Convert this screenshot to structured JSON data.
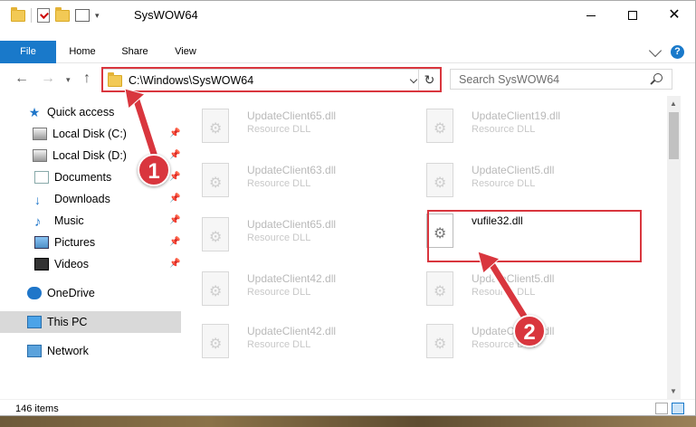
{
  "window": {
    "title": "SysWOW64"
  },
  "ribbon": {
    "tabs": [
      {
        "label": "File"
      },
      {
        "label": "Home"
      },
      {
        "label": "Share"
      },
      {
        "label": "View"
      }
    ]
  },
  "nav": {
    "address": "C:\\Windows\\SysWOW64",
    "search_placeholder": "Search SysWOW64"
  },
  "sidebar": {
    "items": [
      {
        "label": "Quick access"
      },
      {
        "label": "Local Disk (C:)"
      },
      {
        "label": "Local Disk (D:)"
      },
      {
        "label": "Documents"
      },
      {
        "label": "Downloads"
      },
      {
        "label": "Music"
      },
      {
        "label": "Pictures"
      },
      {
        "label": "Videos"
      },
      {
        "label": "OneDrive"
      },
      {
        "label": "This PC"
      },
      {
        "label": "Network"
      }
    ]
  },
  "files": [
    {
      "name": "UpdateClient65.dll",
      "type": "Resource DLL"
    },
    {
      "name": "UpdateClient19.dll",
      "type": "Resource DLL"
    },
    {
      "name": "UpdateClient63.dll",
      "type": "Resource DLL"
    },
    {
      "name": "UpdateClient5.dll",
      "type": "Resource DLL"
    },
    {
      "name": "UpdateClient65.dll",
      "type": "Resource DLL"
    },
    {
      "name": "vufile32.dll",
      "type": ""
    },
    {
      "name": "UpdateClient42.dll",
      "type": "Resource DLL"
    },
    {
      "name": "UpdateClient5.dll",
      "type": "Resource DLL"
    },
    {
      "name": "UpdateClient42.dll",
      "type": "Resource DLL"
    },
    {
      "name": "UpdateClient5.dll",
      "type": "Resource DLL"
    }
  ],
  "status": {
    "item_count": "146 items"
  },
  "annotations": {
    "step1": "1",
    "step2": "2"
  },
  "colors": {
    "accent": "#1979ca",
    "highlight": "#d9363e"
  }
}
